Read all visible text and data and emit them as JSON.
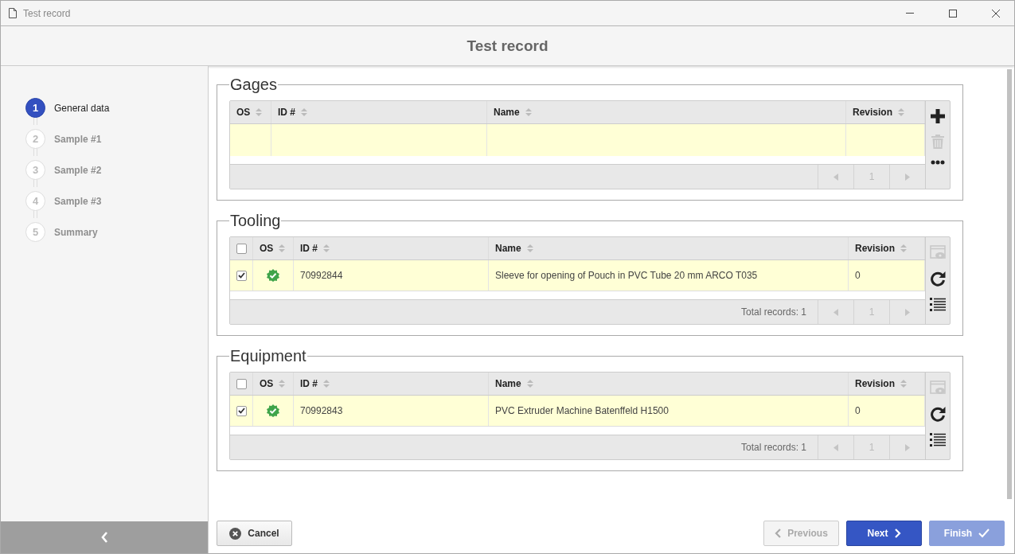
{
  "window": {
    "title": "Test record"
  },
  "header": {
    "title": "Test record"
  },
  "steps": [
    {
      "number": "1",
      "label": "General data",
      "selected": true
    },
    {
      "number": "2",
      "label": "Sample #1",
      "selected": false
    },
    {
      "number": "3",
      "label": "Sample #2",
      "selected": false
    },
    {
      "number": "4",
      "label": "Sample #3",
      "selected": false
    },
    {
      "number": "5",
      "label": "Summary",
      "selected": false
    }
  ],
  "sections": [
    {
      "title": "Gages",
      "columns": [
        {
          "kind": "os",
          "label": "OS"
        },
        {
          "kind": "id",
          "label": "ID #"
        },
        {
          "kind": "name",
          "label": "Name"
        },
        {
          "kind": "revision",
          "label": "Revision"
        }
      ],
      "page": "1",
      "tools": [
        {
          "kind": "add",
          "disabled": false
        },
        {
          "kind": "delete",
          "disabled": true
        },
        {
          "kind": "more",
          "disabled": false
        }
      ]
    },
    {
      "title": "Tooling",
      "select_all": false,
      "columns": [
        {
          "kind": "check"
        },
        {
          "kind": "os",
          "label": "OS"
        },
        {
          "kind": "id",
          "label": "ID #"
        },
        {
          "kind": "name",
          "label": "Name"
        },
        {
          "kind": "revision",
          "label": "Revision"
        }
      ],
      "rows": [
        {
          "checked": true,
          "id": "70992844",
          "name": "Sleeve for opening of Pouch in PVC Tube 20 mm ARCO T035",
          "revision": "0"
        }
      ],
      "total": "Total records: 1",
      "page": "1",
      "tools": [
        {
          "kind": "view",
          "disabled": true
        },
        {
          "kind": "refresh",
          "disabled": false
        },
        {
          "kind": "list",
          "disabled": false
        }
      ]
    },
    {
      "title": "Equipment",
      "select_all": false,
      "columns": [
        {
          "kind": "check"
        },
        {
          "kind": "os",
          "label": "OS"
        },
        {
          "kind": "id",
          "label": "ID #"
        },
        {
          "kind": "name",
          "label": "Name"
        },
        {
          "kind": "revision",
          "label": "Revision"
        }
      ],
      "rows": [
        {
          "checked": true,
          "id": "70992843",
          "name": "PVC Extruder Machine Batenffeld H1500",
          "revision": "0"
        }
      ],
      "total": "Total records: 1",
      "page": "1",
      "tools": [
        {
          "kind": "view",
          "disabled": true
        },
        {
          "kind": "refresh",
          "disabled": false
        },
        {
          "kind": "list",
          "disabled": false
        }
      ]
    }
  ],
  "buttons": [
    {
      "kind": "cancel",
      "label": "Cancel"
    },
    {
      "kind": "previous",
      "label": "Previous",
      "disabled": true
    },
    {
      "kind": "next",
      "label": "Next"
    },
    {
      "kind": "finish",
      "label": "Finish",
      "disabled": true
    }
  ]
}
